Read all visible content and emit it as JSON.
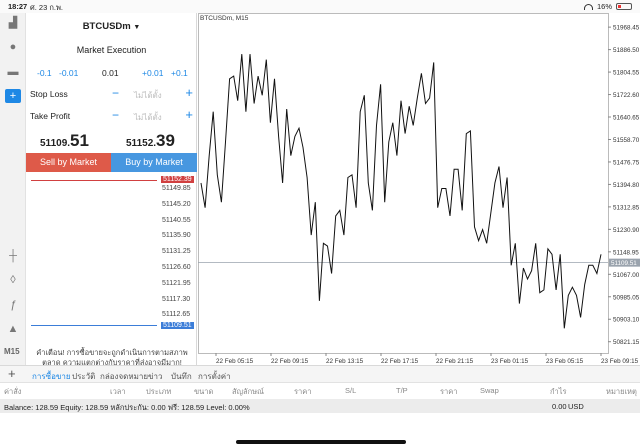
{
  "status_bar": {
    "time": "18:27",
    "date": "ศ. 23 ก.พ.",
    "battery": "16%"
  },
  "toolstrip": {
    "icons": [
      "chart-icon",
      "account-icon",
      "chat-icon",
      "new-order-icon",
      "crosshair-icon",
      "indicators-icon",
      "function-icon",
      "objects-icon"
    ],
    "timeframe": "M15"
  },
  "order_panel": {
    "symbol": "BTCUSDm",
    "symbol_caret": "▼",
    "execution": "Market Execution",
    "volume_steps": {
      "minus_big": "-0.1",
      "minus_small": "-0.01",
      "volume": "0.01",
      "plus_small": "+0.01",
      "plus_big": "+0.1"
    },
    "stop_loss": {
      "label": "Stop Loss",
      "placeholder": "ไม่ได้ตั้ง"
    },
    "take_profit": {
      "label": "Take Profit",
      "placeholder": "ไม่ได้ตั้ง"
    },
    "bid": {
      "prefix": "51109.",
      "suffix": "51"
    },
    "ask": {
      "prefix": "51152.",
      "suffix": "39"
    },
    "sell_label": "Sell by Market",
    "buy_label": "Buy by Market",
    "ladder_ticks": [
      "51149.85",
      "51145.20",
      "51140.55",
      "51135.90",
      "51131.25",
      "51126.60",
      "51121.95",
      "51117.30",
      "51112.65"
    ],
    "ladder_ask": "51152.39",
    "ladder_bid": "51109.51",
    "warning": "คำเตือน! การซื้อขายจะถูกดำเนินการตามสภาพตลาด ความแตกต่างกับราคาที่ส่งอาจมีมาก!"
  },
  "chart": {
    "title": "BTCUSDm, M15",
    "current_price": "51109.51",
    "price_ticks": [
      "51968.45",
      "51886.50",
      "51804.55",
      "51722.60",
      "51640.65",
      "51558.70",
      "51476.75",
      "51394.80",
      "51312.85",
      "51230.90",
      "51148.95",
      "51067.00",
      "50985.05",
      "50903.10",
      "50821.15"
    ],
    "time_ticks": [
      "22 Feb 05:15",
      "22 Feb 09:15",
      "22 Feb 13:15",
      "22 Feb 17:15",
      "22 Feb 21:15",
      "23 Feb 01:15",
      "23 Feb 05:15",
      "23 Feb 09:15"
    ]
  },
  "chart_data": {
    "type": "line",
    "title": "BTCUSDm, M15",
    "x": [
      "22 Feb 05:15",
      "22 Feb 09:15",
      "22 Feb 13:15",
      "22 Feb 17:15",
      "22 Feb 21:15",
      "23 Feb 01:15",
      "23 Feb 05:15",
      "23 Feb 09:15"
    ],
    "ylim": [
      50780,
      52020
    ],
    "series": [
      {
        "values": [
          51400,
          51310,
          51500,
          51660,
          51430,
          51330,
          51550,
          51780,
          51790,
          51700,
          51870,
          51660,
          51870,
          51690,
          51790,
          51720,
          51850,
          51620,
          51780,
          51570,
          51400,
          51670,
          51500,
          51570,
          51600,
          51530,
          51420,
          51210,
          51330,
          50970,
          51180,
          51170,
          51070,
          51280,
          51300,
          51210,
          51420,
          51430,
          51310,
          51660,
          51720,
          51400,
          51300,
          51610,
          51760,
          51330,
          51550,
          51620,
          51500,
          51700,
          51580,
          51680,
          51610,
          51710,
          51800,
          51690,
          51710,
          51840,
          51310,
          51380,
          51380,
          51280,
          51450,
          51450,
          51300,
          51580,
          51590,
          51240,
          51190,
          51230,
          51180,
          51290,
          51400,
          51460,
          51310,
          51420,
          51100,
          51180,
          50960,
          51090,
          51050,
          51080,
          51180,
          51000,
          51010,
          51160,
          51140,
          51010,
          51140,
          50870,
          50990,
          51020,
          50990,
          50910,
          51030,
          51100,
          51100,
          51070,
          51140
        ]
      }
    ]
  },
  "bottom": {
    "tabs": [
      "การซื้อขาย",
      "ประวัติ",
      "กล่องจดหมาย",
      "ข่าว",
      "บันทึก",
      "การตั้งค่า"
    ],
    "columns": [
      "ค่าสั่ง",
      "เวลา",
      "ประเภท",
      "ขนาด",
      "สัญลักษณ์",
      "ราคา",
      "S/L",
      "T/P",
      "ราคา",
      "Swap",
      "กำไร",
      "หมายเหตุ"
    ],
    "balance_line": "Balance: 128.59 Equity: 128.59 หลักประกัน: 0.00 ฟรี: 128.59 Level: 0.00%",
    "profit_value": "0.00",
    "currency": "USD"
  }
}
